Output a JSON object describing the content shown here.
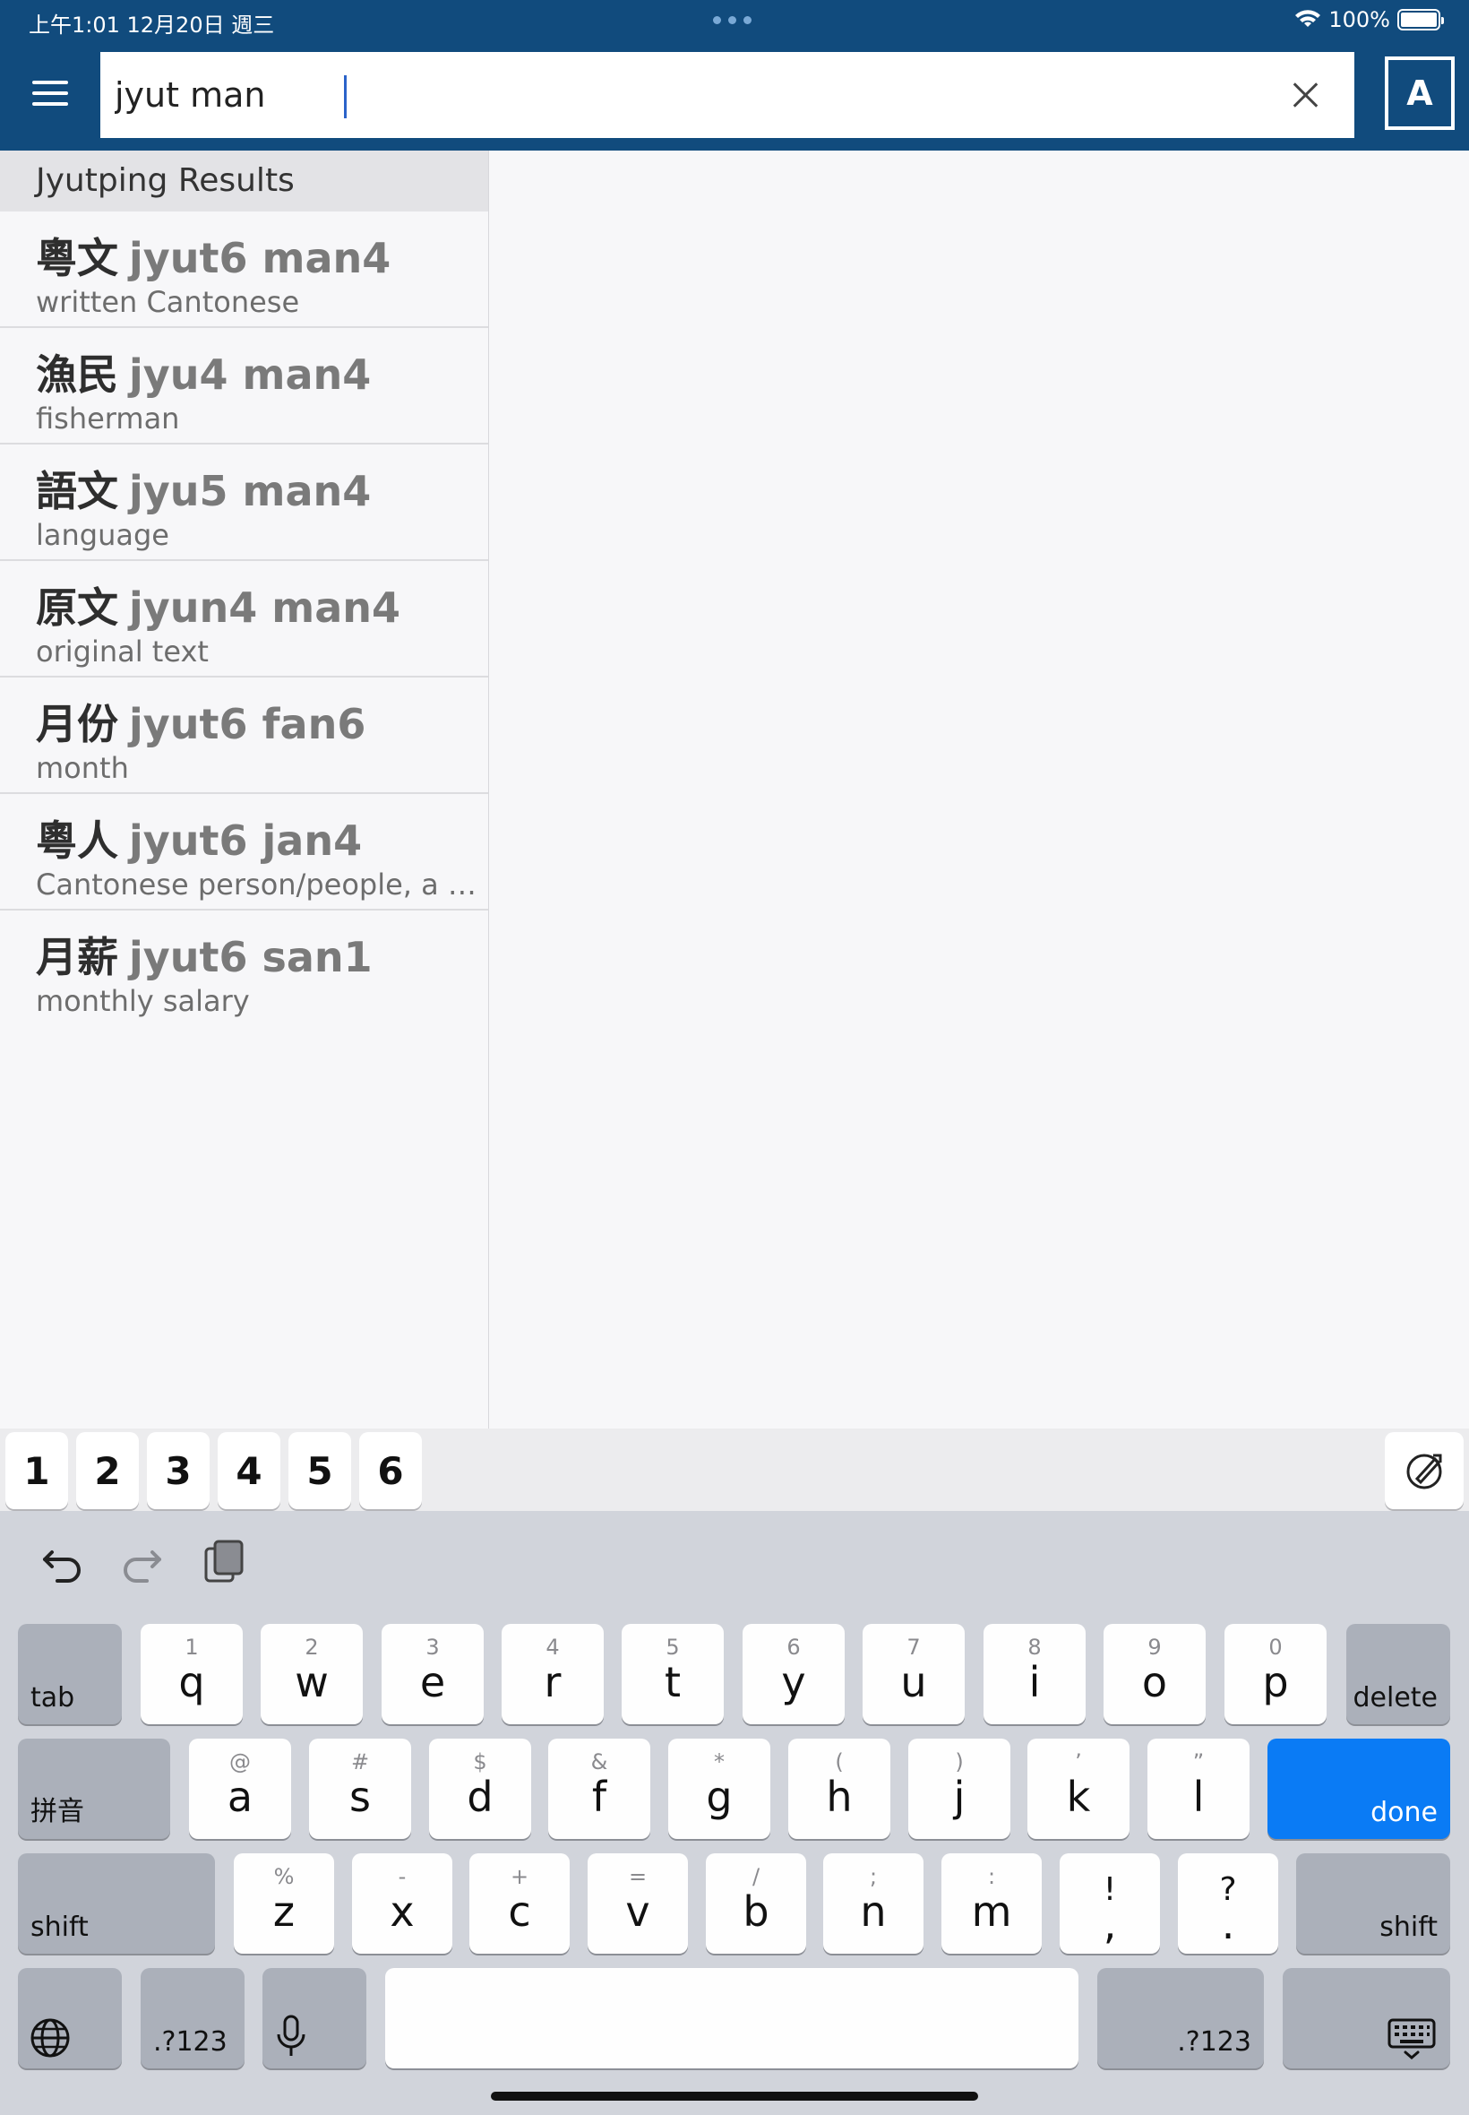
{
  "status_bar": {
    "time_date": "上午1:01  12月20日 週三",
    "battery": "100%"
  },
  "header": {
    "search_value": "jyut man",
    "lang_button": "A"
  },
  "results": {
    "header": "Jyutping Results",
    "items": [
      {
        "chinese": "粵文",
        "jyutping": "jyut6 man4",
        "definition": "written Cantonese"
      },
      {
        "chinese": "漁民",
        "jyutping": "jyu4 man4",
        "definition": "fisherman"
      },
      {
        "chinese": "語文",
        "jyutping": "jyu5 man4",
        "definition": "language"
      },
      {
        "chinese": "原文",
        "jyutping": "jyun4 man4",
        "definition": "original text"
      },
      {
        "chinese": "月份",
        "jyutping": "jyut6 fan6",
        "definition": "month"
      },
      {
        "chinese": "粵人",
        "jyutping": "jyut6 jan4",
        "definition": "Cantonese person/people, a …"
      },
      {
        "chinese": "月薪",
        "jyutping": "jyut6 san1",
        "definition": "monthly salary"
      }
    ]
  },
  "tone_bar": {
    "keys": [
      "1",
      "2",
      "3",
      "4",
      "5",
      "6"
    ]
  },
  "keyboard": {
    "row1": [
      {
        "main": "q",
        "sub": "1"
      },
      {
        "main": "w",
        "sub": "2"
      },
      {
        "main": "e",
        "sub": "3"
      },
      {
        "main": "r",
        "sub": "4"
      },
      {
        "main": "t",
        "sub": "5"
      },
      {
        "main": "y",
        "sub": "6"
      },
      {
        "main": "u",
        "sub": "7"
      },
      {
        "main": "i",
        "sub": "8"
      },
      {
        "main": "o",
        "sub": "9"
      },
      {
        "main": "p",
        "sub": "0"
      }
    ],
    "row2": [
      {
        "main": "a",
        "sub": "@"
      },
      {
        "main": "s",
        "sub": "#"
      },
      {
        "main": "d",
        "sub": "$"
      },
      {
        "main": "f",
        "sub": "&"
      },
      {
        "main": "g",
        "sub": "*"
      },
      {
        "main": "h",
        "sub": "("
      },
      {
        "main": "j",
        "sub": ")"
      },
      {
        "main": "k",
        "sub": "’"
      },
      {
        "main": "l",
        "sub": "”"
      }
    ],
    "row3": [
      {
        "main": "z",
        "sub": "%"
      },
      {
        "main": "x",
        "sub": "-"
      },
      {
        "main": "c",
        "sub": "+"
      },
      {
        "main": "v",
        "sub": "="
      },
      {
        "main": "b",
        "sub": "/"
      },
      {
        "main": "n",
        "sub": ";"
      },
      {
        "main": "m",
        "sub": ":"
      },
      {
        "main": ",",
        "sub": "!"
      },
      {
        "main": ".",
        "sub": "?"
      }
    ],
    "tab": "tab",
    "delete": "delete",
    "pinyin": "拼音",
    "done": "done",
    "shift": "shift",
    "numbers": ".?123"
  },
  "colors": {
    "header_bg": "#114b7d",
    "done_key": "#0a7bf5"
  }
}
